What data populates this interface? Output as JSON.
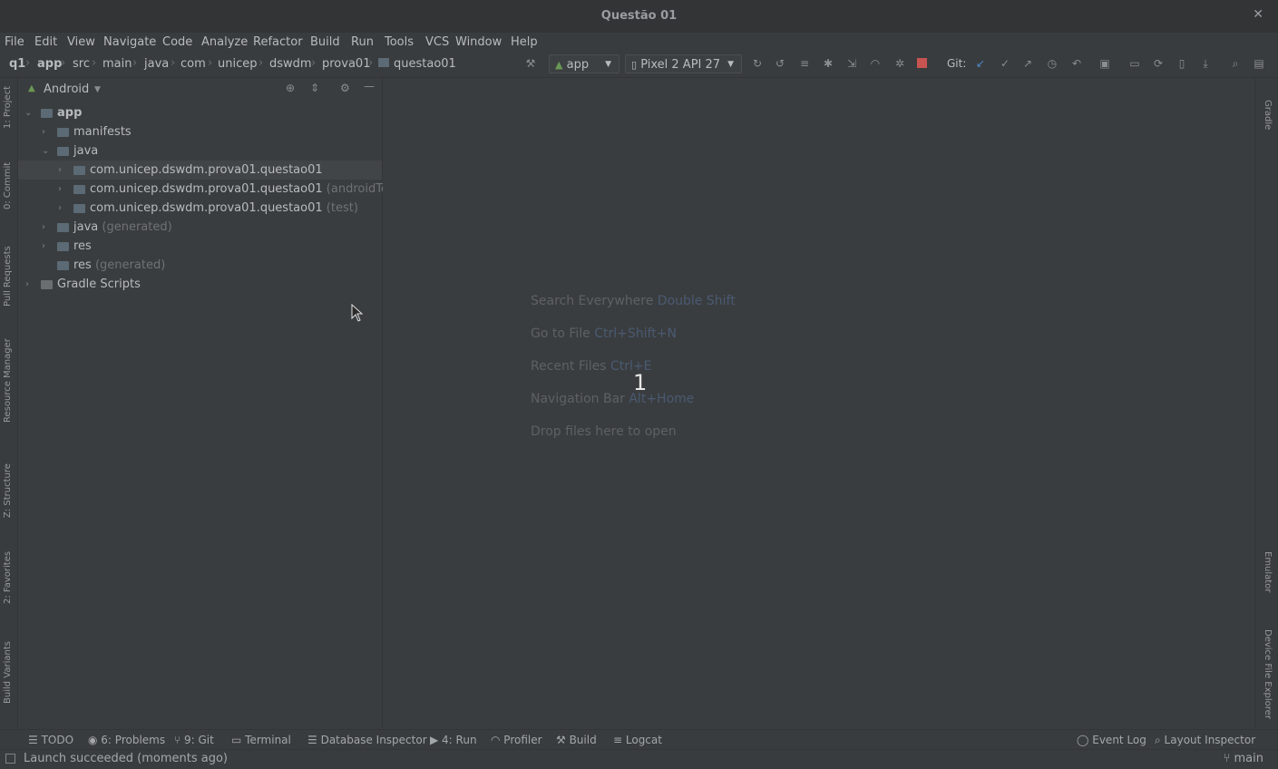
{
  "window": {
    "title": "Questão 01"
  },
  "menu": [
    "File",
    "Edit",
    "View",
    "Navigate",
    "Code",
    "Analyze",
    "Refactor",
    "Build",
    "Run",
    "Tools",
    "VCS",
    "Window",
    "Help"
  ],
  "breadcrumb": [
    "q1",
    "app",
    "src",
    "main",
    "java",
    "com",
    "unicep",
    "dswdm",
    "prova01",
    "questao01"
  ],
  "toolbar": {
    "run_config": "app",
    "device": "Pixel 2 API 27",
    "git_label": "Git:"
  },
  "left_tabs": [
    "1: Project",
    "0: Commit",
    "Pull Requests",
    "Resource Manager",
    "Z: Structure",
    "2: Favorites",
    "Build Variants"
  ],
  "right_tabs": [
    "Gradle",
    "Emulator",
    "Device File Explorer"
  ],
  "project_panel": {
    "view_mode": "Android",
    "tree": [
      {
        "label": "app",
        "suffix": ""
      },
      {
        "label": "manifests",
        "suffix": ""
      },
      {
        "label": "java",
        "suffix": ""
      },
      {
        "label": "com.unicep.dswdm.prova01.questao01",
        "suffix": ""
      },
      {
        "label": "com.unicep.dswdm.prova01.questao01",
        "suffix": "(androidTest)"
      },
      {
        "label": "com.unicep.dswdm.prova01.questao01",
        "suffix": "(test)"
      },
      {
        "label": "java",
        "suffix": "(generated)"
      },
      {
        "label": "res",
        "suffix": ""
      },
      {
        "label": "res",
        "suffix": "(generated)"
      },
      {
        "label": "Gradle Scripts",
        "suffix": ""
      }
    ]
  },
  "editor": {
    "hints": [
      {
        "text": "Search Everywhere",
        "key": "Double Shift"
      },
      {
        "text": "Go to File",
        "key": "Ctrl+Shift+N"
      },
      {
        "text": "Recent Files",
        "key": "Ctrl+E"
      },
      {
        "text": "Navigation Bar",
        "key": "Alt+Home"
      },
      {
        "text": "Drop files here to open",
        "key": ""
      }
    ],
    "overlay_number": "1"
  },
  "bottom_tabs": [
    "TODO",
    "6: Problems",
    "9: Git",
    "Terminal",
    "Database Inspector",
    "4: Run",
    "Profiler",
    "Build",
    "Logcat"
  ],
  "bottom_right_tabs": [
    "Event Log",
    "Layout Inspector"
  ],
  "status": {
    "message": "Launch succeeded (moments ago)",
    "branch": "main"
  }
}
